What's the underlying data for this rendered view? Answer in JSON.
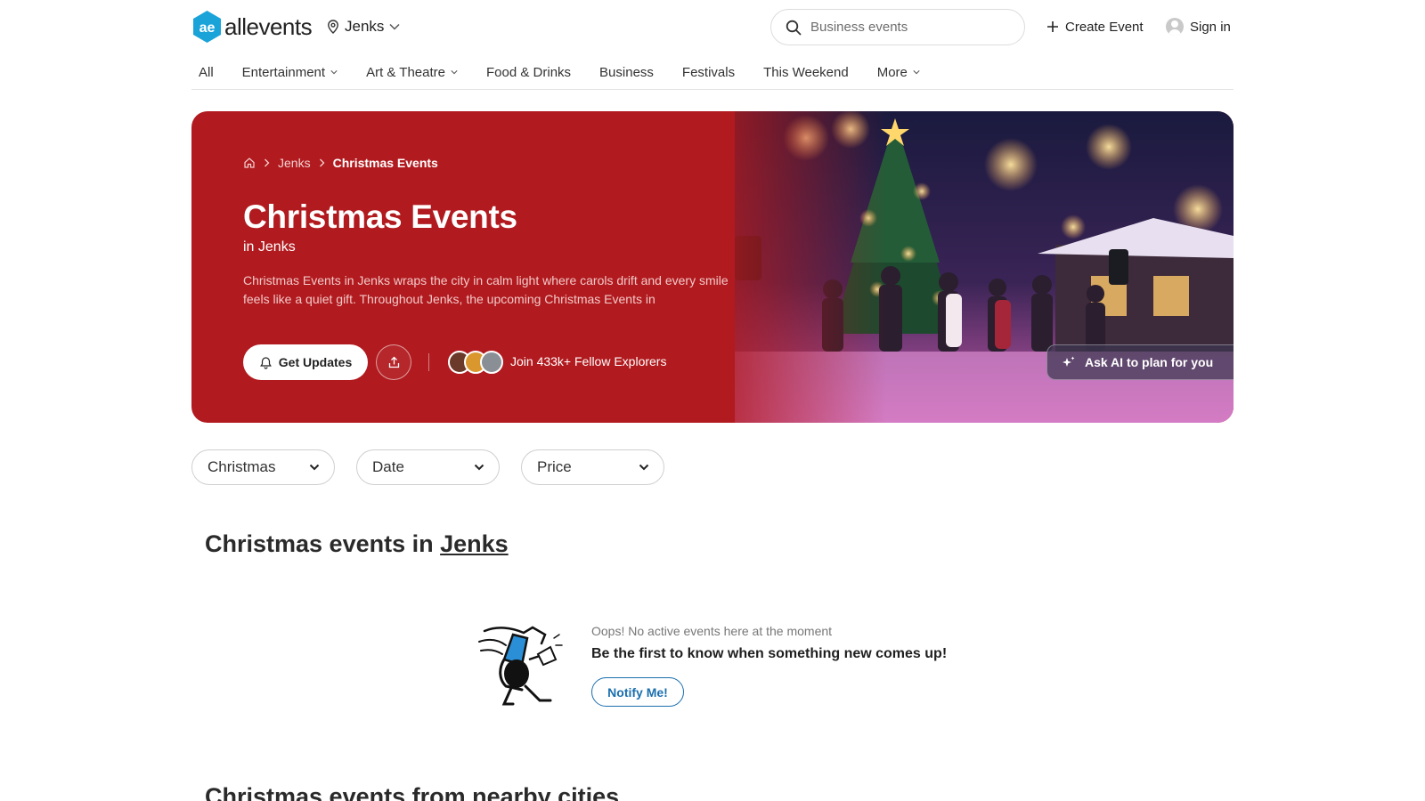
{
  "header": {
    "logo_text": "allevents",
    "location": "Jenks",
    "search_placeholder": "Business events",
    "create_event": "Create Event",
    "sign_in": "Sign in",
    "brand_color": "#1aa3d9"
  },
  "nav": {
    "items": [
      {
        "label": "All",
        "dropdown": false
      },
      {
        "label": "Entertainment",
        "dropdown": true
      },
      {
        "label": "Art & Theatre",
        "dropdown": true
      },
      {
        "label": "Food & Drinks",
        "dropdown": false
      },
      {
        "label": "Business",
        "dropdown": false
      },
      {
        "label": "Festivals",
        "dropdown": false
      },
      {
        "label": "This Weekend",
        "dropdown": false
      },
      {
        "label": "More",
        "dropdown": true
      }
    ]
  },
  "hero": {
    "breadcrumb": [
      "Jenks",
      "Christmas Events"
    ],
    "title": "Christmas Events",
    "subtitle": "in Jenks",
    "description": "Christmas Events in Jenks wraps the city in calm light where carols drift and every smile feels like a quiet gift. Throughout Jenks, the upcoming Christmas Events in",
    "get_updates": "Get Updates",
    "explorers": "Join 433k+ Fellow Explorers",
    "ask_ai": "Ask AI to plan for you",
    "background_color": "#b11a1e"
  },
  "filters": [
    {
      "label": "Christmas"
    },
    {
      "label": "Date"
    },
    {
      "label": "Price"
    }
  ],
  "section": {
    "title_prefix": "Christmas events in",
    "title_location": "Jenks",
    "nearby_title": "Christmas events from nearby cities"
  },
  "empty_state": {
    "oops": "Oops! No active events here at the moment",
    "message": "Be the first to know when something new comes up!",
    "notify_button": "Notify Me!",
    "accent_color": "#1b6fae"
  }
}
